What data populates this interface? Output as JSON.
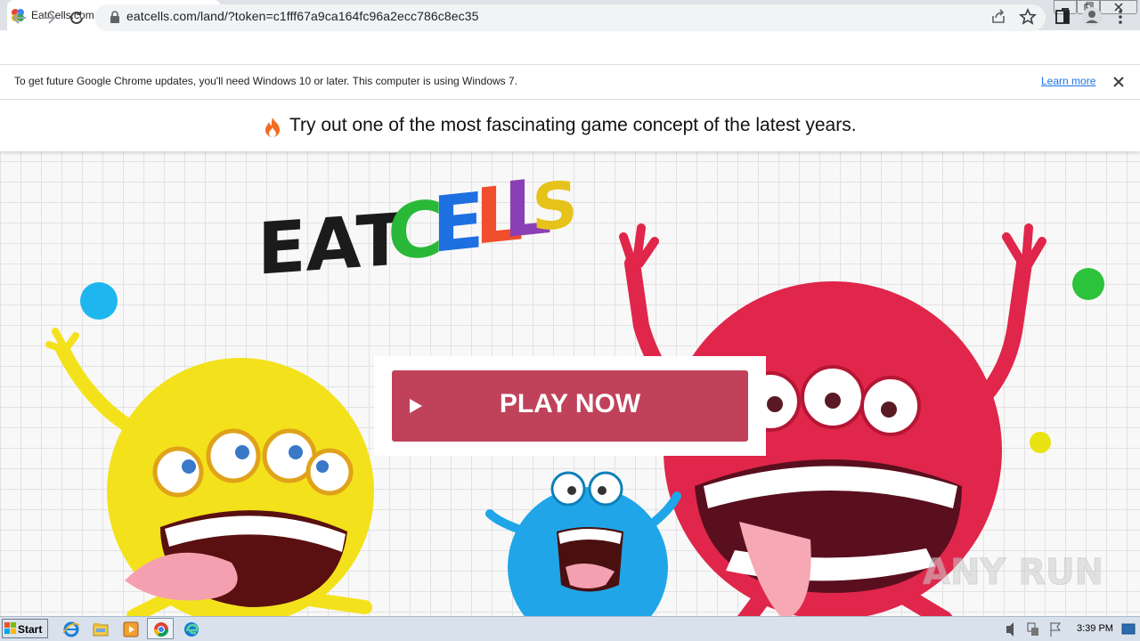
{
  "browser": {
    "tab_title": "EatCells.com",
    "url": "eatcells.com/land/?token=c1fff67a9ca164fc96a2ecc786c8ec35",
    "new_tab_symbol": "+",
    "tab_close_symbol": "✕"
  },
  "infobar": {
    "message": "To get future Google Chrome updates, you'll need Windows 10 or later. This computer is using Windows 7.",
    "link": "Learn more"
  },
  "page": {
    "headline": "Try out one of the most fascinating game concept of the latest years.",
    "logo_word1": "EAT",
    "logo_letters": [
      "C",
      "E",
      "L",
      "L",
      "S"
    ],
    "logo_colors": [
      "#2ab838",
      "#1e6fe0",
      "#f04e2d",
      "#8b3fb4",
      "#e6c21a"
    ],
    "play_button": "PLAY NOW",
    "accent": "#c0425a",
    "watermark": "ANY RUN"
  },
  "taskbar": {
    "start_label": "Start",
    "clock": "3:39 PM",
    "pinned": [
      "internet-explorer",
      "file-explorer",
      "media-player",
      "chrome",
      "edge"
    ]
  }
}
